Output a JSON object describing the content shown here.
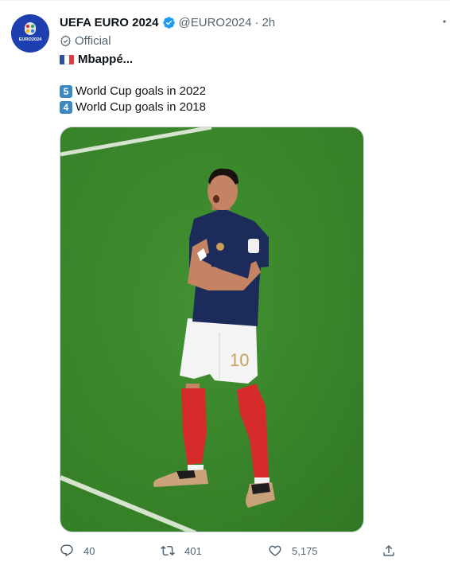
{
  "author": {
    "name": "UEFA EURO 2024",
    "handle": "@EURO2024",
    "separator": "·",
    "time": "2h",
    "official_label": "Official",
    "avatar_text": "EURO2024"
  },
  "tweet": {
    "line1": "Mbappé...",
    "line2_num": "5",
    "line2": "World Cup goals in 2022",
    "line3_num": "4",
    "line3": "World Cup goals in 2018",
    "shirt_number": "10"
  },
  "actions": {
    "replies": "40",
    "retweets": "401",
    "likes": "5,175"
  },
  "colors": {
    "verified": "#1d9bf0",
    "secondary_text": "#536471",
    "pitch": "#3d8a2f"
  },
  "icons": [
    "verified-badge-icon",
    "official-check-icon",
    "france-flag-icon",
    "reply-icon",
    "retweet-icon",
    "like-icon",
    "share-icon",
    "more-icon"
  ]
}
